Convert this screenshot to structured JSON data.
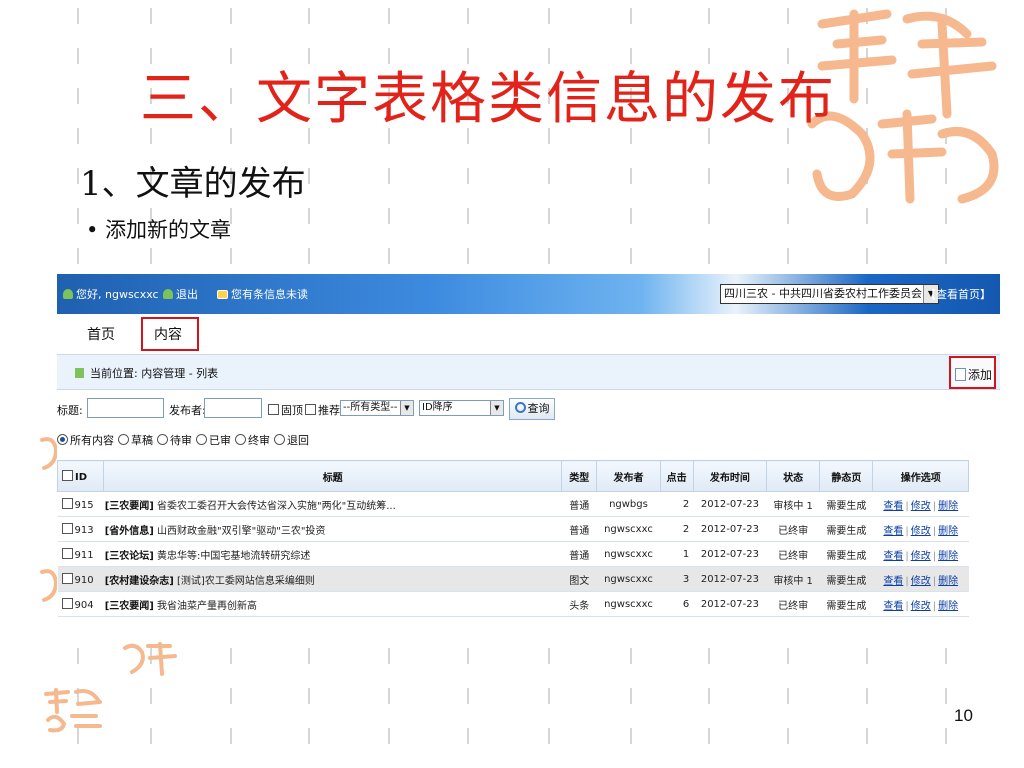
{
  "slide": {
    "title": "三、文字表格类信息的发布",
    "subtitle": "1、文章的发布",
    "bullet": "添加新的文章",
    "page_number": "10"
  },
  "colors": {
    "title": "#e2231a",
    "seal": "#f6b98f",
    "highlight_box": "#d4141c",
    "topbar": "#1f60b0"
  },
  "topbar": {
    "greeting": "您好, ngwscxxc",
    "logout": "退出",
    "messages": "您有条信息未读",
    "site_select": "四川三农 - 中共四川省委农村工作委员会",
    "view_home": "【查看首页】"
  },
  "nav": {
    "tabs": [
      "首页",
      "内容"
    ],
    "active": "内容"
  },
  "breadcrumb": "当前位置: 内容管理 - 列表",
  "add_button": "添加",
  "filters": {
    "title_label": "标题:",
    "author_label": "发布者:",
    "top_label": "固顶",
    "recommend_label": "推荐",
    "type_select": "--所有类型--",
    "order_select": "ID降序",
    "query_button": "查询"
  },
  "status_radios": [
    "所有内容",
    "草稿",
    "待审",
    "已审",
    "终审",
    "退回"
  ],
  "table": {
    "headers": [
      "ID",
      "标题",
      "类型",
      "发布者",
      "点击",
      "发布时间",
      "状态",
      "静态页",
      "操作选项"
    ],
    "actions": [
      "查看",
      "修改",
      "删除"
    ],
    "rows": [
      {
        "id": "915",
        "tag": "[三农要闻]",
        "title": "省委农工委召开大会传达省深入实施\"两化\"互动统筹...",
        "type": "普通",
        "author": "ngwbgs",
        "clicks": "2",
        "date": "2012-07-23",
        "status": "审核中 1",
        "static": "需要生成"
      },
      {
        "id": "913",
        "tag": "[省外信息]",
        "title": "山西财政金融\"双引擎\"驱动\"三农\"投资",
        "type": "普通",
        "author": "ngwscxxc",
        "clicks": "2",
        "date": "2012-07-23",
        "status": "已终审",
        "static": "需要生成"
      },
      {
        "id": "911",
        "tag": "[三农论坛]",
        "title": "黄忠华等:中国宅基地流转研究综述",
        "type": "普通",
        "author": "ngwscxxc",
        "clicks": "1",
        "date": "2012-07-23",
        "status": "已终审",
        "static": "需要生成"
      },
      {
        "id": "910",
        "tag": "[农村建设杂志]",
        "title": "[测试]农工委网站信息采编细则",
        "type": "图文",
        "author": "ngwscxxc",
        "clicks": "3",
        "date": "2012-07-23",
        "status": "审核中 1",
        "static": "需要生成"
      },
      {
        "id": "904",
        "tag": "[三农要闻]",
        "title": "我省油菜产量再创新高",
        "type": "头条",
        "author": "ngwscxxc",
        "clicks": "6",
        "date": "2012-07-23",
        "status": "已终审",
        "static": "需要生成"
      }
    ]
  }
}
